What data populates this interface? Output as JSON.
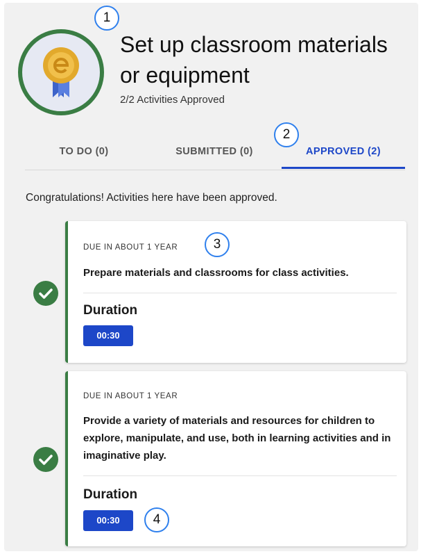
{
  "header": {
    "title": "Set up classroom materials or equipment",
    "subtitle": "2/2 Activities Approved",
    "badge_icon": "ribbon-medal-icon"
  },
  "tabs": [
    {
      "label": "TO DO (0)",
      "active": false
    },
    {
      "label": "SUBMITTED (0)",
      "active": false
    },
    {
      "label": "APPROVED (2)",
      "active": true
    }
  ],
  "message": "Congratulations! Activities here have been approved.",
  "activities": [
    {
      "due": "DUE IN ABOUT 1 YEAR",
      "description": "Prepare materials and classrooms for class activities.",
      "duration_label": "Duration",
      "duration": "00:30",
      "status_icon": "check-circle-icon"
    },
    {
      "due": "DUE IN ABOUT 1 YEAR",
      "description": "Provide a variety of materials and resources for children to explore, manipulate, and use, both in learning activities and in imaginative play.",
      "duration_label": "Duration",
      "duration": "00:30",
      "status_icon": "check-circle-icon"
    }
  ],
  "callouts": [
    "1",
    "2",
    "3",
    "4"
  ],
  "colors": {
    "accent": "#1d47c8",
    "success": "#3a7d44",
    "callout_ring": "#2f80ed"
  }
}
